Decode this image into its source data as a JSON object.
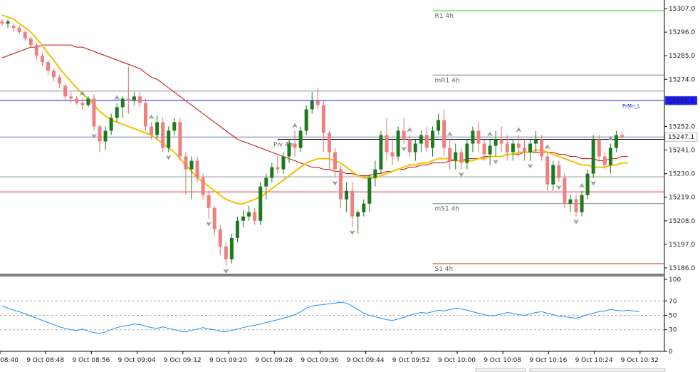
{
  "chart_data": {
    "type": "candlestick",
    "price_axis": {
      "ylim": [
        15183,
        15310
      ],
      "ticks": [
        15186.0,
        15197.0,
        15208.0,
        15219.0,
        15230.0,
        15241.0,
        15252.0,
        15263.0,
        15274.0,
        15285.0,
        15296.0,
        15307.0
      ],
      "tick_labels": [
        "15186.0",
        "15197.0",
        "15208.0",
        "15219.0",
        "15230.0",
        "15241.0",
        "15252.0",
        "15263.0",
        "15274.0",
        "15285.0",
        "15296.0",
        "15307.0"
      ],
      "current_price_label": "15247.1",
      "prmn_price_label": "15264.1"
    },
    "oscillator_axis": {
      "ylim": [
        0,
        100
      ],
      "ticks": [
        100,
        70,
        50,
        30,
        0
      ],
      "tick_labels": [
        "100",
        "70",
        "50",
        "30",
        "0"
      ],
      "dotted_levels": [
        70,
        50,
        30
      ]
    },
    "time_axis": {
      "labels": [
        "9 Oct 08:40",
        "9 Oct 08:48",
        "9 Oct 08:56",
        "9 Oct 09:04",
        "9 Oct 09:12",
        "9 Oct 09:20",
        "9 Oct 09:28",
        "9 Oct 09:36",
        "9 Oct 09:44",
        "9 Oct 09:52",
        "9 Oct 10:00",
        "9 Oct 10:08",
        "9 Oct 10:16",
        "9 Oct 10:24",
        "9 Oct 10:32"
      ]
    },
    "levels": [
      {
        "name": "R1 4h",
        "value": 15306.0,
        "color": "#32cd32",
        "start_bar": 75
      },
      {
        "name": "mR1 4h",
        "value": 15276.0,
        "color": "#808080",
        "start_bar": 75
      },
      {
        "name": "Piv 4h",
        "value": 15246.0,
        "color": "#000000",
        "start_bar": 48
      },
      {
        "name": "mS1 4h",
        "value": 15216.0,
        "color": "#808080",
        "start_bar": 75
      },
      {
        "name": "S1 4h",
        "value": 15188.0,
        "color": "#dd2020",
        "start_bar": 75
      }
    ],
    "reference_lines": [
      {
        "name": "PrMn_L",
        "value": 15264.1,
        "color": "#1a1aff"
      },
      {
        "value": 15247.1,
        "color": "#7080b0"
      },
      {
        "value": 15268.5,
        "color": "#909090"
      },
      {
        "value": 15228.5,
        "color": "#909090"
      },
      {
        "value": 15221.5,
        "color": "#ee2222"
      }
    ],
    "ohlc": [
      [
        15301,
        15302,
        15299,
        15300
      ],
      [
        15300,
        15302,
        15298,
        15301
      ],
      [
        15299,
        15300,
        15296,
        15298
      ],
      [
        15298,
        15299,
        15295,
        15296
      ],
      [
        15296,
        15297,
        15292,
        15293
      ],
      [
        15293,
        15294,
        15289,
        15290
      ],
      [
        15290,
        15291,
        15283,
        15285
      ],
      [
        15285,
        15286,
        15280,
        15282
      ],
      [
        15282,
        15283,
        15276,
        15278
      ],
      [
        15278,
        15279,
        15273,
        15275
      ],
      [
        15275,
        15276,
        15270,
        15272
      ],
      [
        15271,
        15272,
        15264,
        15266
      ],
      [
        15266,
        15268,
        15263,
        15265
      ],
      [
        15265,
        15266,
        15262,
        15263
      ],
      [
        15263,
        15265,
        15260,
        15262
      ],
      [
        15262,
        15266,
        15261,
        15265
      ],
      [
        15265,
        15267,
        15250,
        15252
      ],
      [
        15252,
        15253,
        15240,
        15245
      ],
      [
        15245,
        15252,
        15241,
        15250
      ],
      [
        15250,
        15258,
        15248,
        15256
      ],
      [
        15256,
        15263,
        15254,
        15261
      ],
      [
        15261,
        15266,
        15256,
        15265
      ],
      [
        15265,
        15280,
        15258,
        15264
      ],
      [
        15264,
        15268,
        15262,
        15266
      ],
      [
        15266,
        15268,
        15261,
        15263
      ],
      [
        15263,
        15265,
        15250,
        15252
      ],
      [
        15252,
        15254,
        15246,
        15248
      ],
      [
        15248,
        15257,
        15246,
        15254
      ],
      [
        15254,
        15256,
        15240,
        15242
      ],
      [
        15242,
        15252,
        15240,
        15250
      ],
      [
        15250,
        15256,
        15248,
        15254
      ],
      [
        15254,
        15256,
        15236,
        15238
      ],
      [
        15238,
        15240,
        15220,
        15232
      ],
      [
        15232,
        15238,
        15218,
        15236
      ],
      [
        15236,
        15238,
        15226,
        15228
      ],
      [
        15228,
        15230,
        15218,
        15220
      ],
      [
        15220,
        15222,
        15209,
        15214
      ],
      [
        15214,
        15215,
        15201,
        15204
      ],
      [
        15204,
        15206,
        15192,
        15196
      ],
      [
        15196,
        15198,
        15187,
        15190
      ],
      [
        15190,
        15202,
        15188,
        15200
      ],
      [
        15200,
        15210,
        15198,
        15208
      ],
      [
        15208,
        15213,
        15205,
        15210
      ],
      [
        15210,
        15215,
        15208,
        15212
      ],
      [
        15212,
        15214,
        15206,
        15208
      ],
      [
        15208,
        15226,
        15206,
        15224
      ],
      [
        15224,
        15230,
        15218,
        15228
      ],
      [
        15228,
        15235,
        15226,
        15233
      ],
      [
        15233,
        15238,
        15230,
        15232
      ],
      [
        15232,
        15240,
        15230,
        15238
      ],
      [
        15238,
        15246,
        15235,
        15244
      ],
      [
        15244,
        15250,
        15238,
        15242
      ],
      [
        15242,
        15252,
        15240,
        15250
      ],
      [
        15250,
        15262,
        15248,
        15260
      ],
      [
        15260,
        15268,
        15258,
        15264
      ],
      [
        15264,
        15270,
        15260,
        15262
      ],
      [
        15262,
        15264,
        15240,
        15249
      ],
      [
        15249,
        15250,
        15232,
        15240
      ],
      [
        15240,
        15242,
        15228,
        15232
      ],
      [
        15232,
        15234,
        15214,
        15218
      ],
      [
        15218,
        15226,
        15212,
        15222
      ],
      [
        15222,
        15226,
        15205,
        15210
      ],
      [
        15210,
        15213,
        15202,
        15212
      ],
      [
        15212,
        15218,
        15210,
        15216
      ],
      [
        15216,
        15230,
        15212,
        15228
      ],
      [
        15228,
        15236,
        15224,
        15232
      ],
      [
        15232,
        15250,
        15230,
        15248
      ],
      [
        15248,
        15256,
        15236,
        15240
      ],
      [
        15240,
        15246,
        15234,
        15238
      ],
      [
        15238,
        15252,
        15236,
        15250
      ],
      [
        15250,
        15256,
        15244,
        15246
      ],
      [
        15246,
        15248,
        15238,
        15240
      ],
      [
        15240,
        15246,
        15236,
        15244
      ],
      [
        15244,
        15250,
        15240,
        15248
      ],
      [
        15248,
        15252,
        15240,
        15242
      ],
      [
        15242,
        15252,
        15238,
        15250
      ],
      [
        15250,
        15258,
        15248,
        15255
      ],
      [
        15255,
        15260,
        15238,
        15242
      ],
      [
        15242,
        15246,
        15232,
        15236
      ],
      [
        15236,
        15244,
        15232,
        15240
      ],
      [
        15240,
        15242,
        15232,
        15235
      ],
      [
        15235,
        15246,
        15232,
        15244
      ],
      [
        15244,
        15252,
        15240,
        15250
      ],
      [
        15250,
        15254,
        15240,
        15244
      ],
      [
        15244,
        15246,
        15236,
        15239
      ],
      [
        15239,
        15246,
        15234,
        15243
      ],
      [
        15243,
        15250,
        15238,
        15246
      ],
      [
        15246,
        15252,
        15240,
        15244
      ],
      [
        15244,
        15248,
        15236,
        15240
      ],
      [
        15240,
        15246,
        15236,
        15244
      ],
      [
        15244,
        15248,
        15238,
        15242
      ],
      [
        15242,
        15246,
        15236,
        15240
      ],
      [
        15240,
        15246,
        15236,
        15244
      ],
      [
        15244,
        15250,
        15240,
        15246
      ],
      [
        15246,
        15248,
        15236,
        15238
      ],
      [
        15238,
        15240,
        15222,
        15225
      ],
      [
        15225,
        15236,
        15222,
        15234
      ],
      [
        15234,
        15236,
        15226,
        15228
      ],
      [
        15228,
        15230,
        15214,
        15216
      ],
      [
        15216,
        15220,
        15212,
        15218
      ],
      [
        15218,
        15220,
        15210,
        15212
      ],
      [
        15212,
        15222,
        15210,
        15220
      ],
      [
        15220,
        15232,
        15218,
        15230
      ],
      [
        15230,
        15248,
        15228,
        15246
      ],
      [
        15246,
        15248,
        15236,
        15238
      ],
      [
        15238,
        15240,
        15232,
        15234
      ],
      [
        15234,
        15244,
        15230,
        15242
      ],
      [
        15242,
        15250,
        15240,
        15248
      ],
      [
        15248,
        15250,
        15246,
        15247.1
      ]
    ],
    "ma_fast": [
      15304,
      15303,
      15302,
      15300,
      15298,
      15296,
      15293,
      15290,
      15286,
      15283,
      15279,
      15276,
      15273,
      15270,
      15267,
      15265,
      15262,
      15259,
      15257,
      15255,
      15254,
      15253,
      15252,
      15251,
      15250,
      15249,
      15248,
      15246,
      15244,
      15242,
      15240,
      15237,
      15234,
      15231,
      15228,
      15226,
      15224,
      15222,
      15220,
      15218,
      15217,
      15216,
      15216,
      15217,
      15218,
      15219,
      15221,
      15223,
      15225,
      15227,
      15229,
      15231,
      15233,
      15235,
      15236,
      15237,
      15237,
      15237,
      15236,
      15235,
      15233,
      15231,
      15229,
      15228,
      15228,
      15228,
      15229,
      15230,
      15231,
      15232,
      15233,
      15234,
      15234,
      15235,
      15235,
      15236,
      15237,
      15237,
      15237,
      15236,
      15236,
      15236,
      15236,
      15237,
      15237,
      15238,
      15238,
      15238,
      15239,
      15239,
      15240,
      15240,
      15240,
      15241,
      15241,
      15240,
      15239,
      15238,
      15237,
      15236,
      15235,
      15234,
      15234,
      15233,
      15233,
      15233,
      15234,
      15234,
      15235,
      15235
    ],
    "ma_slow": [
      15284,
      15285,
      15286,
      15287,
      15288,
      15289,
      15289,
      15290,
      15290,
      15290,
      15290,
      15290,
      15290,
      15289,
      15289,
      15288,
      15287,
      15286,
      15285,
      15284,
      15283,
      15282,
      15281,
      15280,
      15279,
      15277,
      15275,
      15274,
      15272,
      15270,
      15268,
      15266,
      15264,
      15262,
      15260,
      15258,
      15256,
      15254,
      15252,
      15250,
      15248,
      15246,
      15245,
      15244,
      15243,
      15242,
      15241,
      15240,
      15239,
      15238,
      15237,
      15236,
      15235,
      15234,
      15233,
      15233,
      15232,
      15232,
      15231,
      15231,
      15230,
      15230,
      15229,
      15229,
      15229,
      15230,
      15230,
      15231,
      15231,
      15232,
      15232,
      15233,
      15233,
      15234,
      15234,
      15235,
      15235,
      15235,
      15236,
      15236,
      15236,
      15237,
      15237,
      15237,
      15238,
      15238,
      15238,
      15238,
      15239,
      15239,
      15239,
      15240,
      15240,
      15240,
      15240,
      15240,
      15240,
      15239,
      15239,
      15238,
      15238,
      15237,
      15237,
      15237,
      15236,
      15236,
      15237,
      15237,
      15238,
      15238
    ],
    "oscillator": [
      63,
      60,
      57,
      55,
      52,
      49,
      46,
      43,
      40,
      37,
      34,
      32,
      30,
      29,
      31,
      28,
      26,
      25,
      27,
      30,
      33,
      35,
      36,
      38,
      37,
      35,
      33,
      32,
      34,
      32,
      30,
      28,
      27,
      29,
      31,
      33,
      31,
      30,
      28,
      27,
      29,
      31,
      33,
      35,
      36,
      38,
      40,
      42,
      44,
      46,
      48,
      51,
      55,
      60,
      63,
      64,
      65,
      66,
      67,
      68,
      67,
      63,
      58,
      53,
      50,
      48,
      46,
      44,
      43,
      45,
      47,
      50,
      52,
      54,
      53,
      55,
      57,
      56,
      58,
      60,
      59,
      57,
      55,
      53,
      51,
      49,
      50,
      52,
      54,
      53,
      51,
      50,
      52,
      54,
      55,
      53,
      51,
      49,
      48,
      47,
      46,
      48,
      51,
      53,
      55,
      56,
      58,
      57,
      56,
      57,
      56,
      55
    ]
  }
}
